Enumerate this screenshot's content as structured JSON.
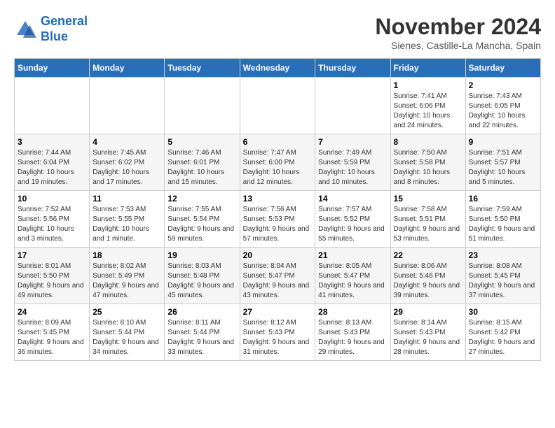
{
  "logo": {
    "line1": "General",
    "line2": "Blue"
  },
  "title": "November 2024",
  "location": "Sienes, Castille-La Mancha, Spain",
  "days_of_week": [
    "Sunday",
    "Monday",
    "Tuesday",
    "Wednesday",
    "Thursday",
    "Friday",
    "Saturday"
  ],
  "weeks": [
    [
      {
        "day": "",
        "info": ""
      },
      {
        "day": "",
        "info": ""
      },
      {
        "day": "",
        "info": ""
      },
      {
        "day": "",
        "info": ""
      },
      {
        "day": "",
        "info": ""
      },
      {
        "day": "1",
        "info": "Sunrise: 7:41 AM\nSunset: 6:06 PM\nDaylight: 10 hours and 24 minutes."
      },
      {
        "day": "2",
        "info": "Sunrise: 7:43 AM\nSunset: 6:05 PM\nDaylight: 10 hours and 22 minutes."
      }
    ],
    [
      {
        "day": "3",
        "info": "Sunrise: 7:44 AM\nSunset: 6:04 PM\nDaylight: 10 hours and 19 minutes."
      },
      {
        "day": "4",
        "info": "Sunrise: 7:45 AM\nSunset: 6:02 PM\nDaylight: 10 hours and 17 minutes."
      },
      {
        "day": "5",
        "info": "Sunrise: 7:46 AM\nSunset: 6:01 PM\nDaylight: 10 hours and 15 minutes."
      },
      {
        "day": "6",
        "info": "Sunrise: 7:47 AM\nSunset: 6:00 PM\nDaylight: 10 hours and 12 minutes."
      },
      {
        "day": "7",
        "info": "Sunrise: 7:49 AM\nSunset: 5:59 PM\nDaylight: 10 hours and 10 minutes."
      },
      {
        "day": "8",
        "info": "Sunrise: 7:50 AM\nSunset: 5:58 PM\nDaylight: 10 hours and 8 minutes."
      },
      {
        "day": "9",
        "info": "Sunrise: 7:51 AM\nSunset: 5:57 PM\nDaylight: 10 hours and 5 minutes."
      }
    ],
    [
      {
        "day": "10",
        "info": "Sunrise: 7:52 AM\nSunset: 5:56 PM\nDaylight: 10 hours and 3 minutes."
      },
      {
        "day": "11",
        "info": "Sunrise: 7:53 AM\nSunset: 5:55 PM\nDaylight: 10 hours and 1 minute."
      },
      {
        "day": "12",
        "info": "Sunrise: 7:55 AM\nSunset: 5:54 PM\nDaylight: 9 hours and 59 minutes."
      },
      {
        "day": "13",
        "info": "Sunrise: 7:56 AM\nSunset: 5:53 PM\nDaylight: 9 hours and 57 minutes."
      },
      {
        "day": "14",
        "info": "Sunrise: 7:57 AM\nSunset: 5:52 PM\nDaylight: 9 hours and 55 minutes."
      },
      {
        "day": "15",
        "info": "Sunrise: 7:58 AM\nSunset: 5:51 PM\nDaylight: 9 hours and 53 minutes."
      },
      {
        "day": "16",
        "info": "Sunrise: 7:59 AM\nSunset: 5:50 PM\nDaylight: 9 hours and 51 minutes."
      }
    ],
    [
      {
        "day": "17",
        "info": "Sunrise: 8:01 AM\nSunset: 5:50 PM\nDaylight: 9 hours and 49 minutes."
      },
      {
        "day": "18",
        "info": "Sunrise: 8:02 AM\nSunset: 5:49 PM\nDaylight: 9 hours and 47 minutes."
      },
      {
        "day": "19",
        "info": "Sunrise: 8:03 AM\nSunset: 5:48 PM\nDaylight: 9 hours and 45 minutes."
      },
      {
        "day": "20",
        "info": "Sunrise: 8:04 AM\nSunset: 5:47 PM\nDaylight: 9 hours and 43 minutes."
      },
      {
        "day": "21",
        "info": "Sunrise: 8:05 AM\nSunset: 5:47 PM\nDaylight: 9 hours and 41 minutes."
      },
      {
        "day": "22",
        "info": "Sunrise: 8:06 AM\nSunset: 5:46 PM\nDaylight: 9 hours and 39 minutes."
      },
      {
        "day": "23",
        "info": "Sunrise: 8:08 AM\nSunset: 5:45 PM\nDaylight: 9 hours and 37 minutes."
      }
    ],
    [
      {
        "day": "24",
        "info": "Sunrise: 8:09 AM\nSunset: 5:45 PM\nDaylight: 9 hours and 36 minutes."
      },
      {
        "day": "25",
        "info": "Sunrise: 8:10 AM\nSunset: 5:44 PM\nDaylight: 9 hours and 34 minutes."
      },
      {
        "day": "26",
        "info": "Sunrise: 8:11 AM\nSunset: 5:44 PM\nDaylight: 9 hours and 33 minutes."
      },
      {
        "day": "27",
        "info": "Sunrise: 8:12 AM\nSunset: 5:43 PM\nDaylight: 9 hours and 31 minutes."
      },
      {
        "day": "28",
        "info": "Sunrise: 8:13 AM\nSunset: 5:43 PM\nDaylight: 9 hours and 29 minutes."
      },
      {
        "day": "29",
        "info": "Sunrise: 8:14 AM\nSunset: 5:43 PM\nDaylight: 9 hours and 28 minutes."
      },
      {
        "day": "30",
        "info": "Sunrise: 8:15 AM\nSunset: 5:42 PM\nDaylight: 9 hours and 27 minutes."
      }
    ]
  ]
}
